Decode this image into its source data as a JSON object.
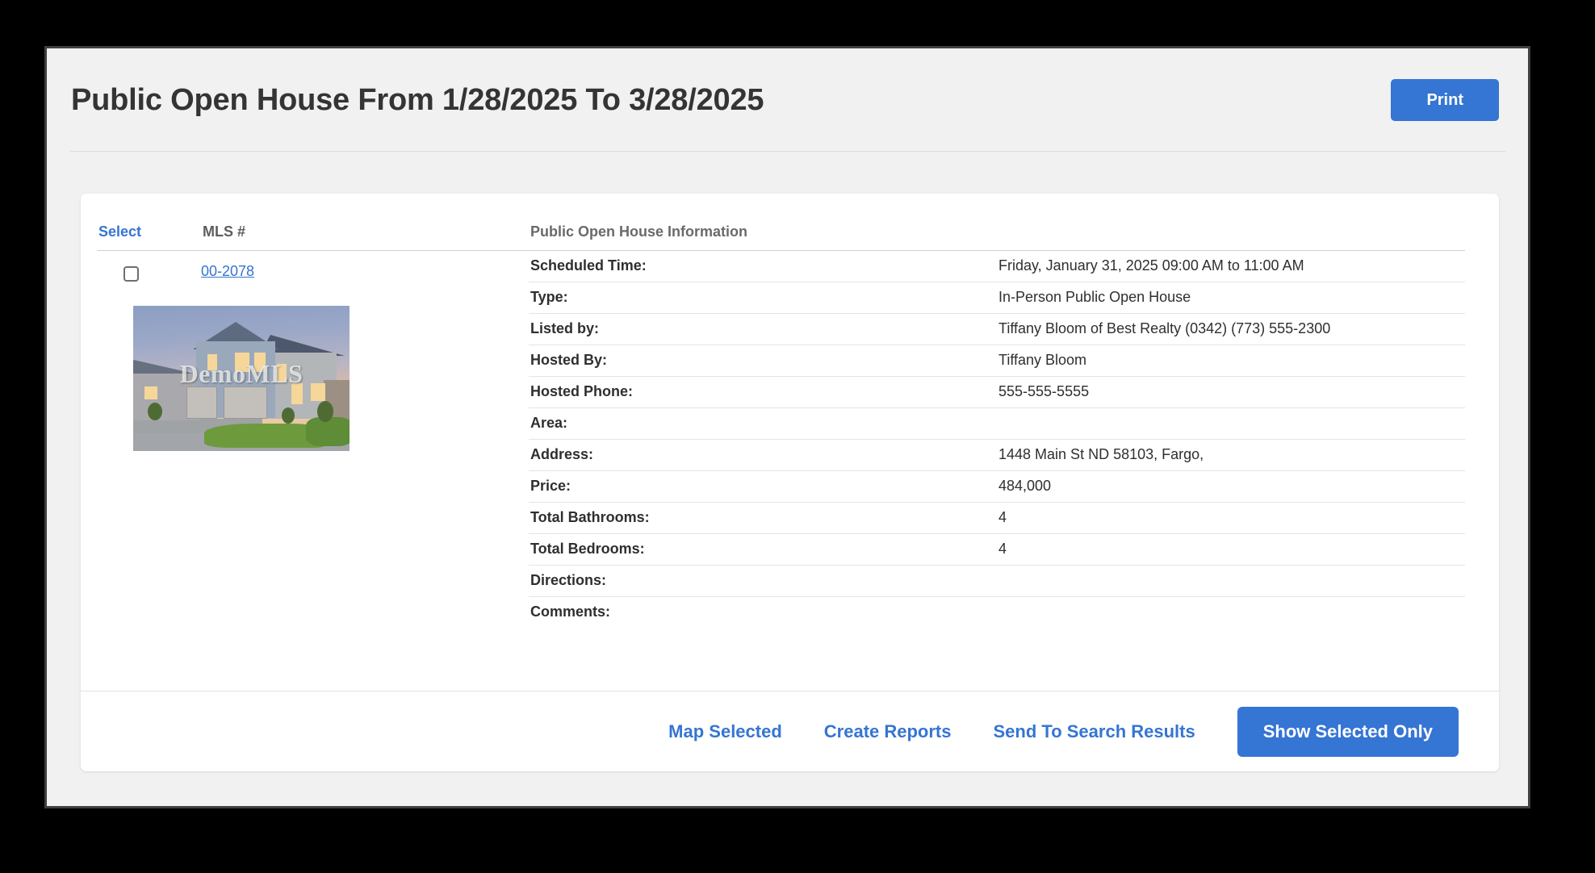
{
  "header": {
    "title": "Public Open House From 1/28/2025 To 3/28/2025",
    "print_label": "Print"
  },
  "colors": {
    "accent_blue": "#3575d3",
    "title_text": "#343434",
    "muted_header": "#6a6a6a",
    "backdrop": "#000000",
    "modal_bg": "#f1f1f1",
    "card_bg": "#ffffff"
  },
  "listing_table": {
    "columns": {
      "select": "Select",
      "mls": "MLS #",
      "info": "Public Open House Information"
    },
    "row": {
      "mls_number": "00-2078",
      "checkbox_checked": false,
      "photo_watermark": "DemoMLS",
      "photo_alt": "house-exterior-dusk"
    },
    "details": [
      {
        "label": "Scheduled Time:",
        "value": "Friday, January 31, 2025 09:00 AM to 11:00 AM"
      },
      {
        "label": "Type:",
        "value": "In-Person Public Open House"
      },
      {
        "label": "Listed by:",
        "value": "Tiffany Bloom of Best Realty (0342) (773) 555-2300"
      },
      {
        "label": "Hosted By:",
        "value": "Tiffany Bloom"
      },
      {
        "label": "Hosted Phone:",
        "value": "555-555-5555"
      },
      {
        "label": "Area:",
        "value": ""
      },
      {
        "label": "Address:",
        "value": "1448 Main St ND 58103, Fargo,"
      },
      {
        "label": "Price:",
        "value": "484,000"
      },
      {
        "label": "Total Bathrooms:",
        "value": "4"
      },
      {
        "label": "Total Bedrooms:",
        "value": "4"
      },
      {
        "label": "Directions:",
        "value": ""
      },
      {
        "label": "Comments:",
        "value": ""
      }
    ]
  },
  "footer": {
    "map_selected": "Map Selected",
    "create_reports": "Create Reports",
    "send_to_search_results": "Send To Search Results",
    "show_selected_only": "Show Selected Only"
  }
}
